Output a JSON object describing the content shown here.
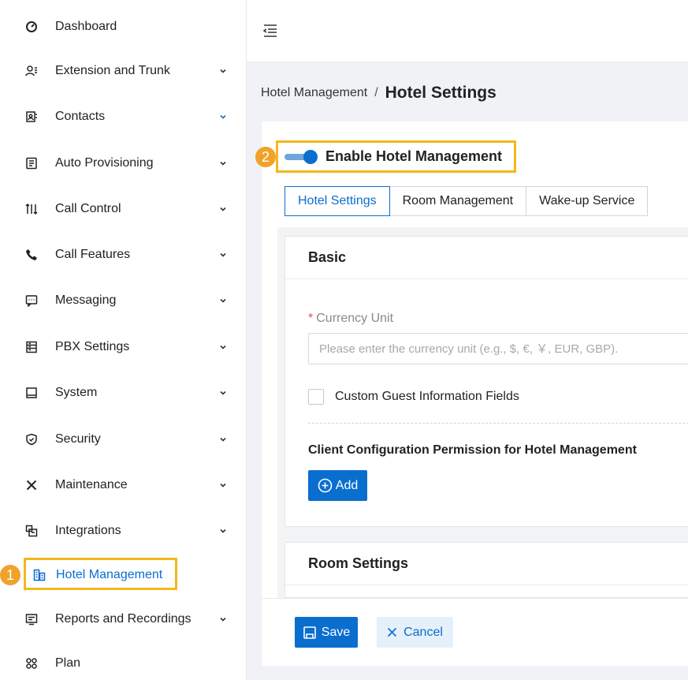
{
  "sidebar": {
    "items": [
      {
        "label": "Dashboard",
        "icon": "dashboard-icon",
        "has_submenu": false
      },
      {
        "label": "Extension and Trunk",
        "icon": "users-icon",
        "has_submenu": true
      },
      {
        "label": "Contacts",
        "icon": "contacts-icon",
        "has_submenu": true
      },
      {
        "label": "Auto Provisioning",
        "icon": "provisioning-icon",
        "has_submenu": true
      },
      {
        "label": "Call Control",
        "icon": "call-control-icon",
        "has_submenu": true
      },
      {
        "label": "Call Features",
        "icon": "phone-icon",
        "has_submenu": true
      },
      {
        "label": "Messaging",
        "icon": "message-icon",
        "has_submenu": true
      },
      {
        "label": "PBX Settings",
        "icon": "pbx-settings-icon",
        "has_submenu": true
      },
      {
        "label": "System",
        "icon": "monitor-icon",
        "has_submenu": true
      },
      {
        "label": "Security",
        "icon": "shield-icon",
        "has_submenu": true
      },
      {
        "label": "Maintenance",
        "icon": "tools-icon",
        "has_submenu": true
      },
      {
        "label": "Integrations",
        "icon": "integrations-icon",
        "has_submenu": true
      },
      {
        "label": "Hotel Management",
        "icon": "hotel-icon",
        "has_submenu": false,
        "active": true
      },
      {
        "label": "Reports and Recordings",
        "icon": "reports-icon",
        "has_submenu": true
      },
      {
        "label": "Plan",
        "icon": "plan-icon",
        "has_submenu": false
      }
    ]
  },
  "annotations": {
    "step1": "1",
    "step2": "2",
    "highlight_color": "#f2b81c",
    "badge_color": "#f0a22b"
  },
  "breadcrumb": {
    "parent": "Hotel Management",
    "separator": "/",
    "current": "Hotel Settings"
  },
  "hotel": {
    "enable_label": "Enable Hotel Management",
    "enabled": true,
    "tabs": [
      {
        "label": "Hotel Settings",
        "active": true
      },
      {
        "label": "Room Management",
        "active": false
      },
      {
        "label": "Wake-up Service",
        "active": false
      }
    ],
    "basic": {
      "title": "Basic",
      "currency": {
        "required_mark": "*",
        "label": "Currency Unit",
        "placeholder": "Please enter the currency unit (e.g., $, €, ￥, EUR, GBP).",
        "value": ""
      },
      "custom_guest_fields_label": "Custom Guest Information Fields",
      "custom_guest_fields_checked": false,
      "permission_label": "Client Configuration Permission for Hotel Management",
      "add_label": "Add"
    },
    "room_settings": {
      "title": "Room Settings"
    }
  },
  "footer": {
    "save_label": "Save",
    "cancel_label": "Cancel"
  },
  "colors": {
    "primary": "#0a6ecf",
    "required": "#e34d4d"
  }
}
